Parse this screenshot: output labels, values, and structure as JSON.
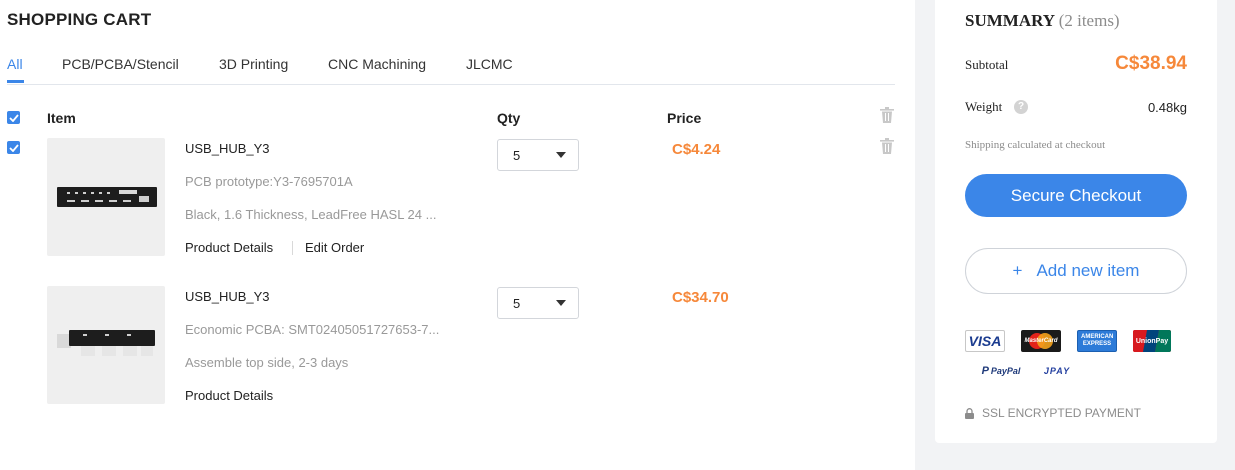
{
  "cart": {
    "title": "SHOPPING CART",
    "tabs": [
      {
        "label": "All",
        "active": true
      },
      {
        "label": "PCB/PCBA/Stencil",
        "active": false
      },
      {
        "label": "3D Printing",
        "active": false
      },
      {
        "label": "CNC Machining",
        "active": false
      },
      {
        "label": "JLCMC",
        "active": false
      }
    ],
    "columns": {
      "item": "Item",
      "qty": "Qty",
      "price": "Price"
    },
    "items": [
      {
        "name": "USB_HUB_Y3",
        "line1": "PCB prototype:Y3-7695701A",
        "line2": "Black, 1.6 Thickness, LeadFree HASL 24 ...",
        "qty": "5",
        "price": "C$4.24",
        "links": [
          "Product Details",
          "Edit Order"
        ]
      },
      {
        "name": "USB_HUB_Y3",
        "line1": "Economic PCBA: SMT02405051727653-7...",
        "line2": "Assemble top side, 2-3 days",
        "qty": "5",
        "price": "C$34.70",
        "links": [
          "Product Details"
        ]
      }
    ]
  },
  "summary": {
    "title": "SUMMARY",
    "count": "(2 items)",
    "subtotal_label": "Subtotal",
    "subtotal_value": "C$38.94",
    "weight_label": "Weight",
    "weight_value": "0.48kg",
    "help_glyph": "?",
    "shipping_note": "Shipping calculated at checkout",
    "checkout_label": "Secure Checkout",
    "add_label": "Add new item",
    "add_icon": "+",
    "payment_methods": [
      "VISA",
      "MasterCard",
      "AMERICAN EXPRESS",
      "UnionPay",
      "PayPal",
      "JPAY"
    ],
    "ssl_label": "SSL ENCRYPTED PAYMENT"
  },
  "colors": {
    "accent": "#3b86e8",
    "price": "#f6883a",
    "muted": "#999999",
    "panel_bg": "#f2f3f5"
  }
}
